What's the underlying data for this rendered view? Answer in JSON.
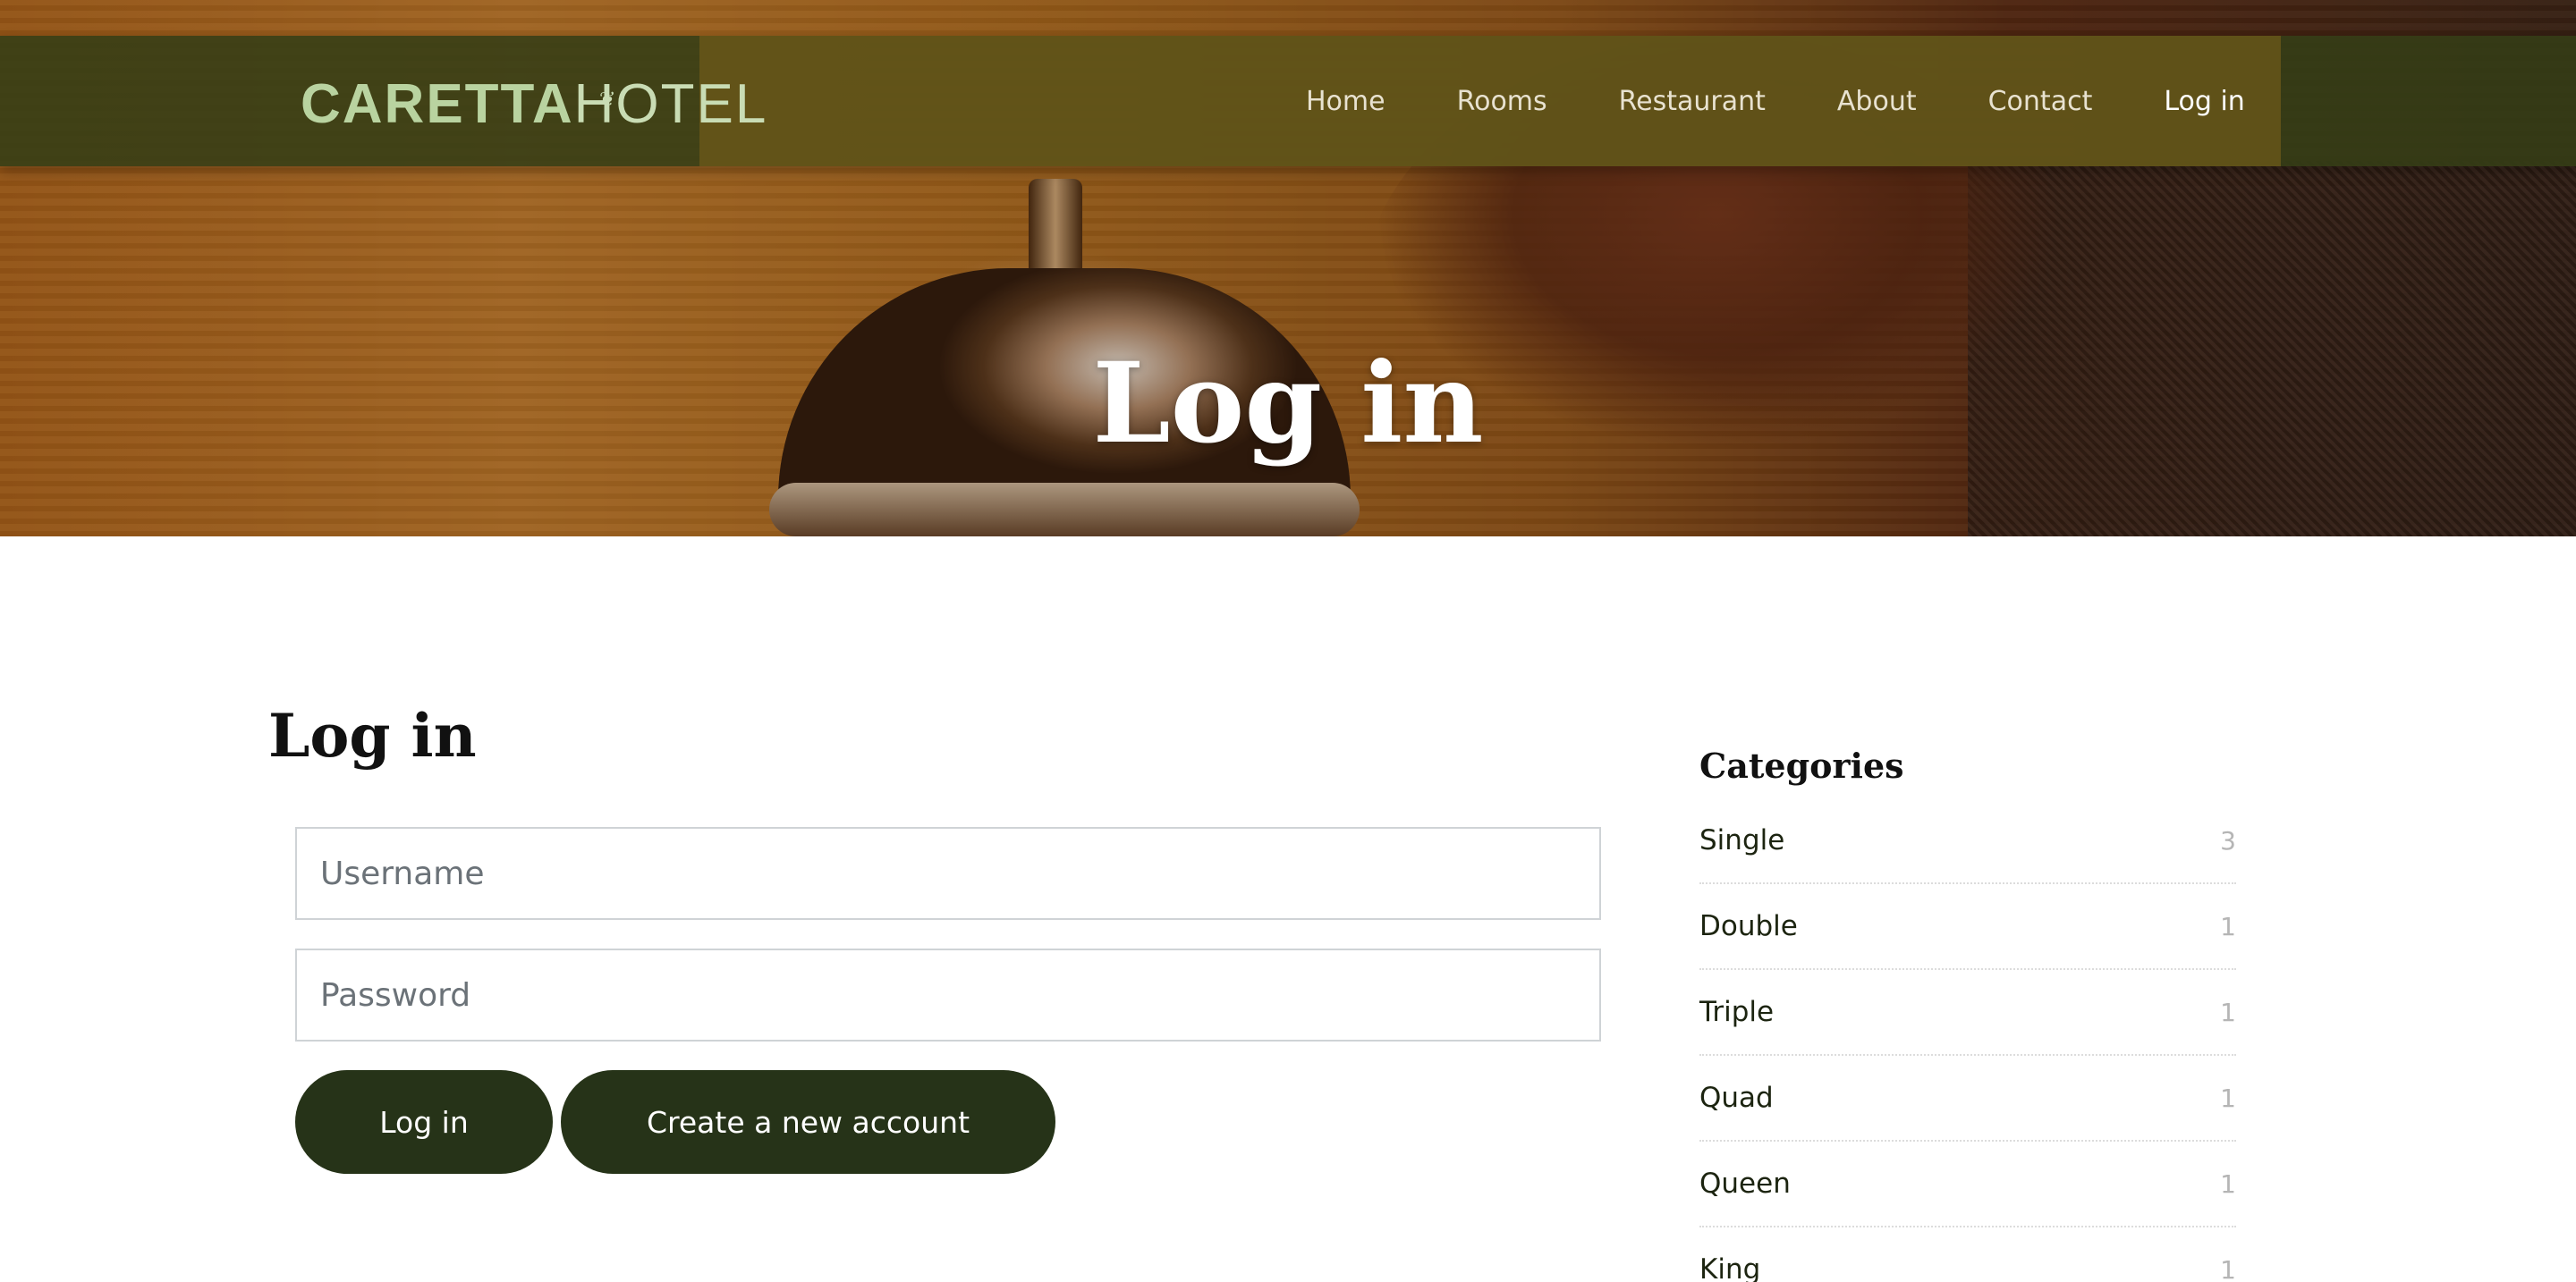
{
  "header": {
    "logo_brand": "CARETTA",
    "logo_suffix": "HOTEL",
    "nav": [
      {
        "label": "Home"
      },
      {
        "label": "Rooms"
      },
      {
        "label": "Restaurant"
      },
      {
        "label": "About"
      },
      {
        "label": "Contact"
      },
      {
        "label": "Log in",
        "active": true
      }
    ]
  },
  "hero": {
    "title": "Log in"
  },
  "login": {
    "heading": "Log in",
    "username_placeholder": "Username",
    "password_placeholder": "Password",
    "login_button": "Log in",
    "create_account_button": "Create a new account"
  },
  "sidebar": {
    "title": "Categories",
    "items": [
      {
        "name": "Single",
        "count": "3"
      },
      {
        "name": "Double",
        "count": "1"
      },
      {
        "name": "Triple",
        "count": "1"
      },
      {
        "name": "Quad",
        "count": "1"
      },
      {
        "name": "Queen",
        "count": "1"
      },
      {
        "name": "King",
        "count": "1"
      }
    ]
  },
  "colors": {
    "nav_bg": "#343e16",
    "button_bg": "#263318",
    "logo": "#b9d3a0"
  }
}
